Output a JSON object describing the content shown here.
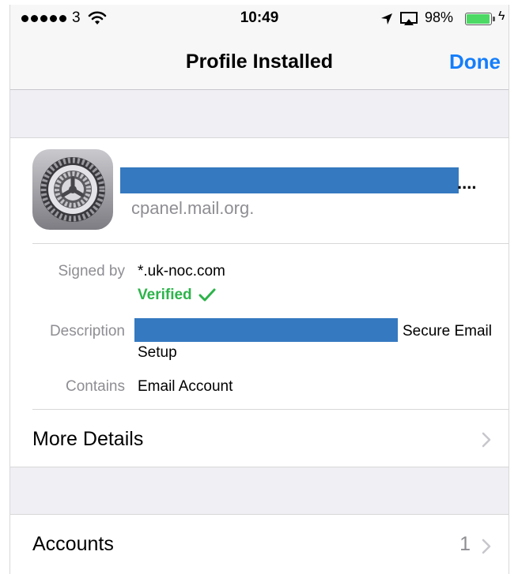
{
  "status_bar": {
    "carrier": "3",
    "time": "10:49",
    "battery_percent": "98%",
    "battery_level": 0.98,
    "icons": [
      "signal-dots-icon",
      "wifi-icon",
      "location-arrow-icon",
      "airplay-icon",
      "battery-icon",
      "charging-bolt-icon"
    ]
  },
  "nav": {
    "title": "Profile Installed",
    "done_label": "Done"
  },
  "profile": {
    "icon": "settings-gear-icon",
    "name_suffix": "....",
    "domain": "cpanel.mail.org.",
    "signed_by_label": "Signed by",
    "signed_by_value": "*.uk-noc.com",
    "verified_label": "Verified",
    "description_label": "Description",
    "description_value_line1": "Secure Email",
    "description_value_line2": "Setup",
    "contains_label": "Contains",
    "contains_value": "Email Account",
    "more_details_label": "More Details"
  },
  "accounts": {
    "label": "Accounts",
    "count": "1"
  },
  "colors": {
    "accent": "#157efb",
    "verified": "#2db34a",
    "redaction": "#3579c0",
    "secondary_text": "#8e8e93",
    "grouped_background": "#efeff4"
  }
}
